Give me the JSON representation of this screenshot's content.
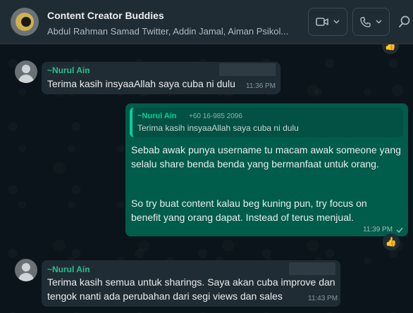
{
  "header": {
    "title": "Content Creator Buddies",
    "participants": "Abdul Rahman Samad Twitter, Addin Jamal, Aiman Psikol..."
  },
  "messages": [
    {
      "sender": "~Nurul Ain",
      "text": "Terima kasih insyaaAllah saya cuba ni dulu",
      "time": "11:36 PM"
    },
    {
      "quoted_sender": "~Nurul Ain",
      "quoted_phone": "+60 16-985 2096",
      "quoted_text": "Terima kasih insyaaAllah saya cuba ni dulu",
      "lines": [
        "Sebab awak punya username tu macam awak someone yang",
        "selalu share benda benda yang bermanfaat untuk orang.",
        "So try buat content kalau beg kuning pun, try focus on",
        "benefit yang orang dapat. Instead of terus menjual."
      ],
      "time": "11:39 PM",
      "reaction": "👍"
    },
    {
      "sender": "~Nurul Ain",
      "lines": [
        "Terima kasih semua untuk sharings. Saya akan cuba improve dan",
        "tengok nanti ada perubahan dari segi views dan sales"
      ],
      "time": "11:43 PM"
    }
  ],
  "top_reaction": "👍",
  "colors": {
    "header_bg": "#202c33",
    "chat_bg": "#0b141a",
    "incoming_bubble": "#202c33",
    "outgoing_bubble": "#005c4b",
    "sender_name": "#25c08e",
    "quote_bar": "#06cf9c"
  },
  "icons": [
    "group-avatar",
    "video-call-icon",
    "voice-call-icon",
    "chevron-down-icon",
    "search-icon",
    "thumbs-up-icon",
    "read-check-icon"
  ]
}
